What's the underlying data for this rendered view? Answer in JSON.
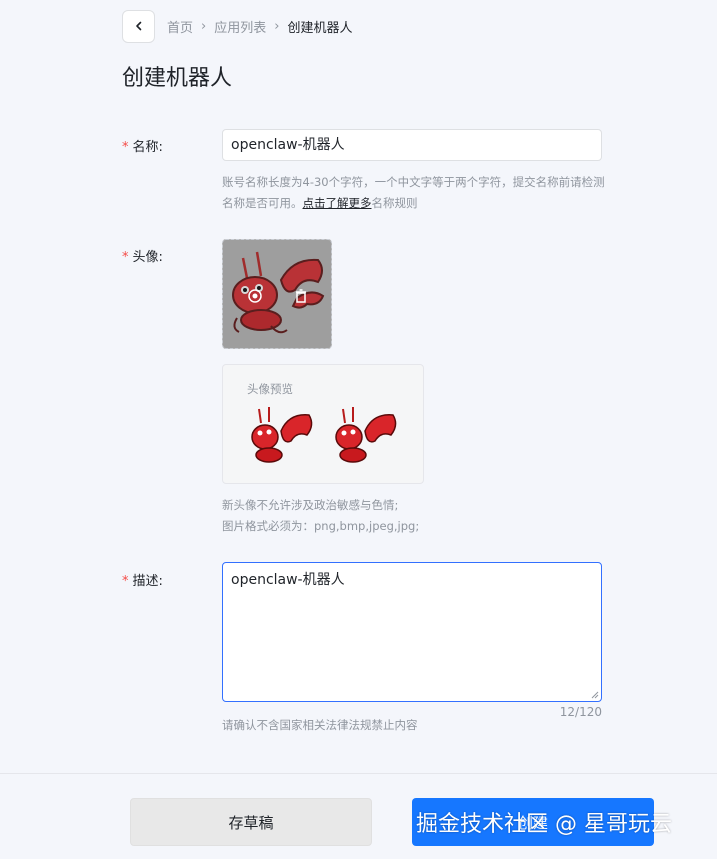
{
  "breadcrumb": {
    "items": [
      "首页",
      "应用列表",
      "创建机器人"
    ]
  },
  "page": {
    "title": "创建机器人"
  },
  "form": {
    "required_mark": "*",
    "name": {
      "label": "名称:",
      "value": "openclaw-机器人",
      "hint_prefix": "账号名称长度为4-30个字符，一个中文字等于两个字符，提交名称前请检测名称是否可用。",
      "hint_link": "点击了解更多",
      "hint_suffix": "名称规则"
    },
    "avatar": {
      "label": "头像:",
      "preview_title": "头像预览",
      "hint_line1": "新头像不允许涉及政治敏感与色情;",
      "hint_line2": "图片格式必须为：png,bmp,jpeg,jpg;"
    },
    "description": {
      "label": "描述:",
      "value": "openclaw-机器人",
      "counter": "12/120",
      "hint": "请确认不含国家相关法律法规禁止内容"
    }
  },
  "footer": {
    "draft_label": "存草稿",
    "create_label": "创建"
  },
  "watermark": "掘金技术社区 @ 星哥玩云",
  "colors": {
    "accent": "#1677ff",
    "required": "#f54a45",
    "lobster_red": "#d9252a"
  }
}
